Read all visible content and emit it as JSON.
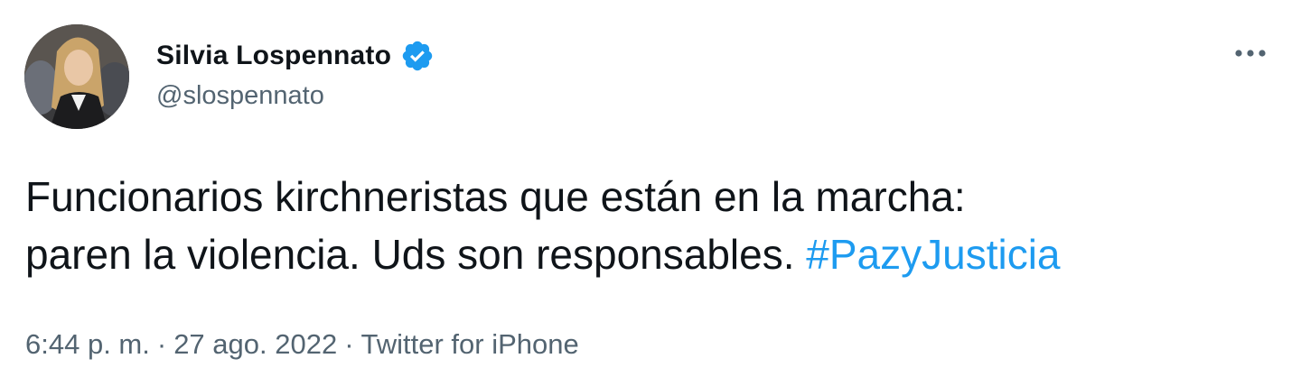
{
  "author": {
    "display_name": "Silvia Lospennato",
    "handle": "@slospennato",
    "verified": true,
    "verified_icon": "verified-badge-icon",
    "avatar_icon": "profile-photo"
  },
  "more_icon": "more-options-icon",
  "tweet": {
    "line1": "Funcionarios kirchneristas que están en la marcha:",
    "line2": "paren la violencia. Uds son responsables.",
    "hashtag": "#PazyJusticia"
  },
  "meta": {
    "time": "6:44 p. m.",
    "separator": "·",
    "date": "27 ago. 2022",
    "source": "Twitter for iPhone"
  },
  "colors": {
    "text": "#0f1419",
    "secondary": "#536471",
    "accent": "#1d9bf0"
  }
}
